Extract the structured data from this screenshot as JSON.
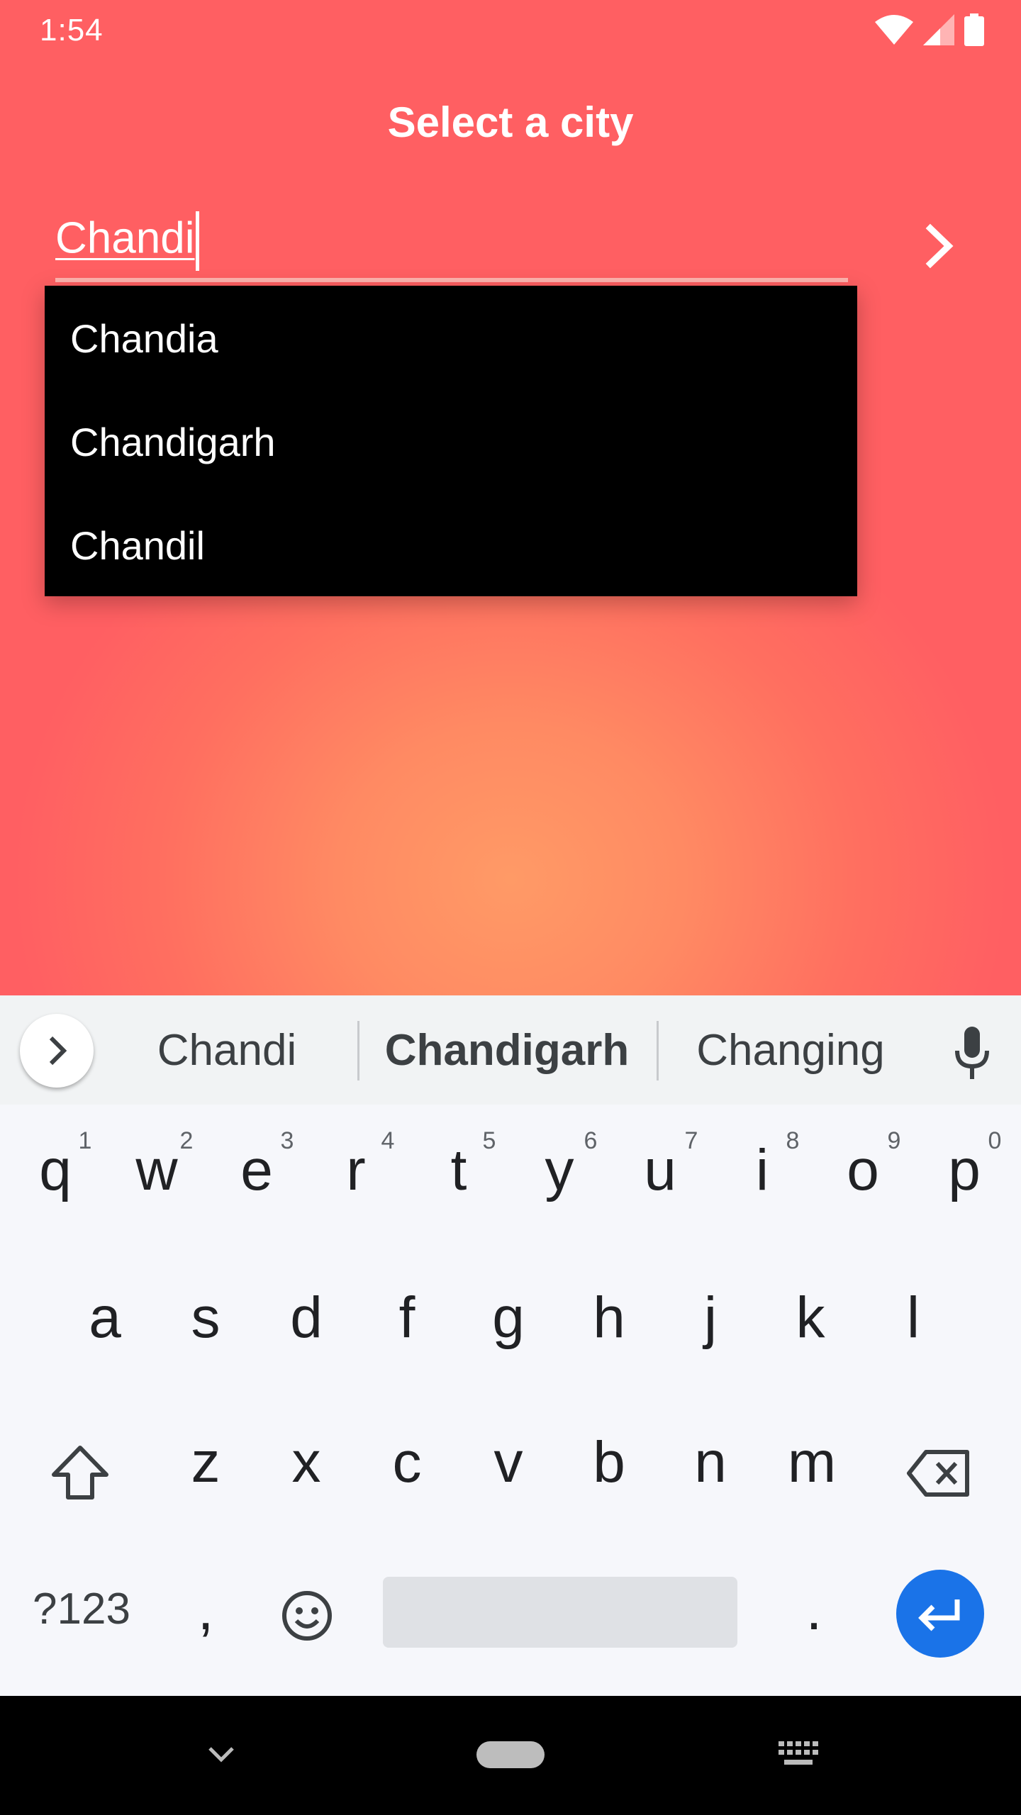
{
  "status_bar": {
    "time": "1:54"
  },
  "page": {
    "title": "Select a city"
  },
  "search": {
    "value": "Chandi"
  },
  "dropdown": {
    "items": [
      "Chandia",
      "Chandigarh",
      "Chandil"
    ]
  },
  "keyboard": {
    "suggestions": [
      "Chandi",
      "Chandigarh",
      "Changing"
    ],
    "row1": [
      "q",
      "w",
      "e",
      "r",
      "t",
      "y",
      "u",
      "i",
      "o",
      "p"
    ],
    "row1_hints": [
      "1",
      "2",
      "3",
      "4",
      "5",
      "6",
      "7",
      "8",
      "9",
      "0"
    ],
    "row2": [
      "a",
      "s",
      "d",
      "f",
      "g",
      "h",
      "j",
      "k",
      "l"
    ],
    "row3": [
      "z",
      "x",
      "c",
      "v",
      "b",
      "n",
      "m"
    ],
    "symbols_label": "?123",
    "comma": ",",
    "period": "."
  },
  "colors": {
    "accent": "#1a73e8",
    "background_top": "#ff5f62",
    "background_center": "#ff9a66"
  }
}
